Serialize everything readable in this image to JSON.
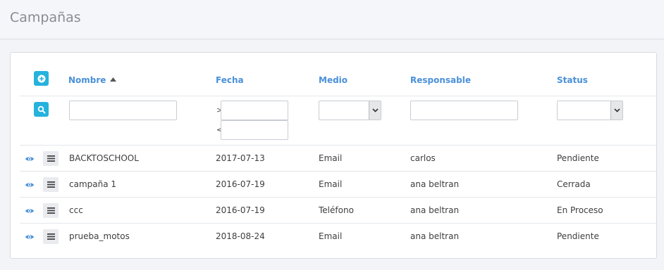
{
  "page": {
    "title": "Campañas"
  },
  "table": {
    "columns": [
      {
        "label": "Nombre",
        "sorted": "ascending"
      },
      {
        "label": "Fecha"
      },
      {
        "label": "Medio"
      },
      {
        "label": "Responsable"
      },
      {
        "label": "Status"
      }
    ],
    "filters": {
      "nombre": {
        "value": ""
      },
      "fecha_gt": {
        "symbol": ">",
        "value": ""
      },
      "fecha_lt": {
        "symbol": "<",
        "value": ""
      },
      "medio": {
        "selected": ""
      },
      "responsable": {
        "value": ""
      },
      "status": {
        "selected": ""
      }
    },
    "rows": [
      {
        "nombre": "BACKTOSCHOOL",
        "fecha": "2017-07-13",
        "medio": "Email",
        "responsable": "carlos",
        "status": "Pendiente"
      },
      {
        "nombre": "campaña 1",
        "fecha": "2016-07-19",
        "medio": "Email",
        "responsable": "ana beltran",
        "status": "Cerrada"
      },
      {
        "nombre": "ccc",
        "fecha": "2016-07-19",
        "medio": "Teléfono",
        "responsable": "ana beltran",
        "status": "En Proceso"
      },
      {
        "nombre": "prueba_motos",
        "fecha": "2018-08-24",
        "medio": "Email",
        "responsable": "ana beltran",
        "status": "Pendiente"
      }
    ]
  },
  "icons": {
    "add": "plus-circle-icon",
    "search": "search-icon",
    "view": "eye-icon",
    "menu": "hamburger-menu-icon",
    "sort": "sort-up-icon",
    "dropdown": "chevron-down-icon"
  },
  "colors": {
    "accent": "#25b2dd",
    "header_link": "#4a90d9",
    "eye": "#4a90d9"
  }
}
